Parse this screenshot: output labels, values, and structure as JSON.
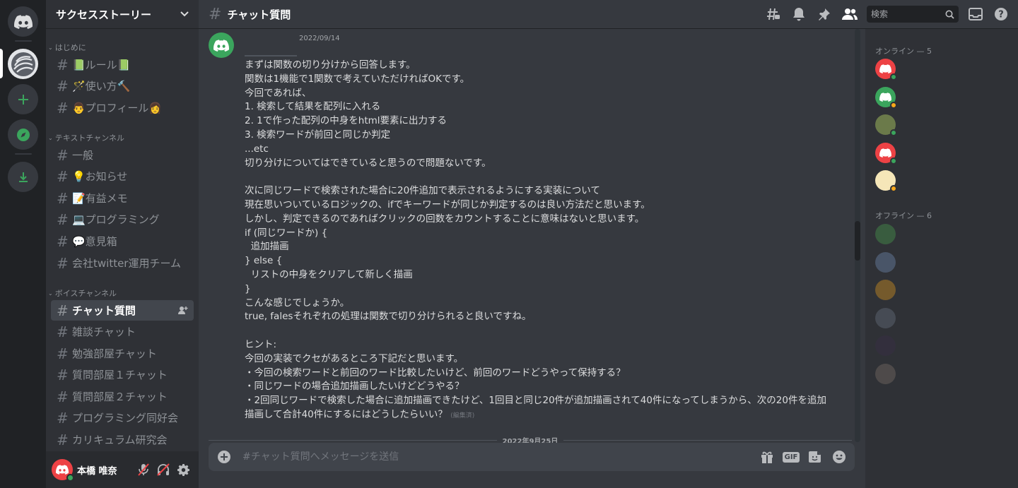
{
  "server": {
    "name": "サクセスストーリー"
  },
  "categories": {
    "intro": "はじめに",
    "text": "テキストチャンネル",
    "voice": "ボイスチャンネル"
  },
  "channels": [
    {
      "label": "📗ルール📗"
    },
    {
      "label": "🪄使い方🔨"
    },
    {
      "label": "👨プロフィール👩"
    },
    {
      "label": "一般"
    },
    {
      "label": "💡お知らせ"
    },
    {
      "label": "📝有益メモ"
    },
    {
      "label": "💻プログラミング"
    },
    {
      "label": "💬意見箱"
    },
    {
      "label": "会社twitter運用チーム"
    },
    {
      "label": "チャット質問"
    },
    {
      "label": "雑談チャット"
    },
    {
      "label": "勉強部屋チャット"
    },
    {
      "label": "質問部屋１チャット"
    },
    {
      "label": "質問部屋２チャット"
    },
    {
      "label": "プログラミング同好会"
    },
    {
      "label": "カリキュラム研究会"
    }
  ],
  "user": {
    "name": "本橋 唯奈"
  },
  "header": {
    "channel": "チャット質問",
    "search_placeholder": "検索"
  },
  "message": {
    "timestamp": "2022/09/14",
    "text": "まずは関数の切り分けから回答します。\n関数は1機能で1関数で考えていただければOKです。\n今回であれば、\n1. 検索して結果を配列に入れる\n2. 1で作った配列の中身をhtml要素に出力する\n3. 検索ワードが前回と同じか判定\n...etc\n切り分けについてはできていると思うので問題ないです。\n\n次に同じワードで検索された場合に20件追加で表示されるようにする実装について\n現在思いついているロジックの、ifでキーワードが同じか判定するのは良い方法だと思います。\nしかし、判定できるのであればクリックの回数をカウントすることに意味はないと思います。\nif (同じワードか) {\n  追加描画\n} else {\n  リストの中身をクリアして新しく描画\n}\nこんな感じでしょうか。\ntrue, falesそれぞれの処理は関数で切り分けられると良いですね。\n\nヒント:\n今回の実装でクセがあるところ下記だと思います。\n・今回の検索ワードと前回のワード比較したいけど、前回のワードどうやって保持する？\n・同じワードの場合追加描画したいけどどうやる？\n・2回同じワードで検索した場合に追加描画できたけど、1回目と同じ20件が追加描画されて40件になってしまうから、次の20件を追加描画して合計40件にするにはどうしたらいい？",
    "edited": "(編集済)"
  },
  "date_divider": "2022年9月25日",
  "composer": {
    "placeholder": "#チャット質問へメッセージを送信",
    "gif_label": "GIF"
  },
  "members": {
    "online_label": "オンライン — 5",
    "offline_label": "オフライン — 6"
  },
  "colors": {
    "blurple": "#5865f2",
    "green": "#3ba55d",
    "red": "#ed4245",
    "idle": "#faa81a"
  }
}
